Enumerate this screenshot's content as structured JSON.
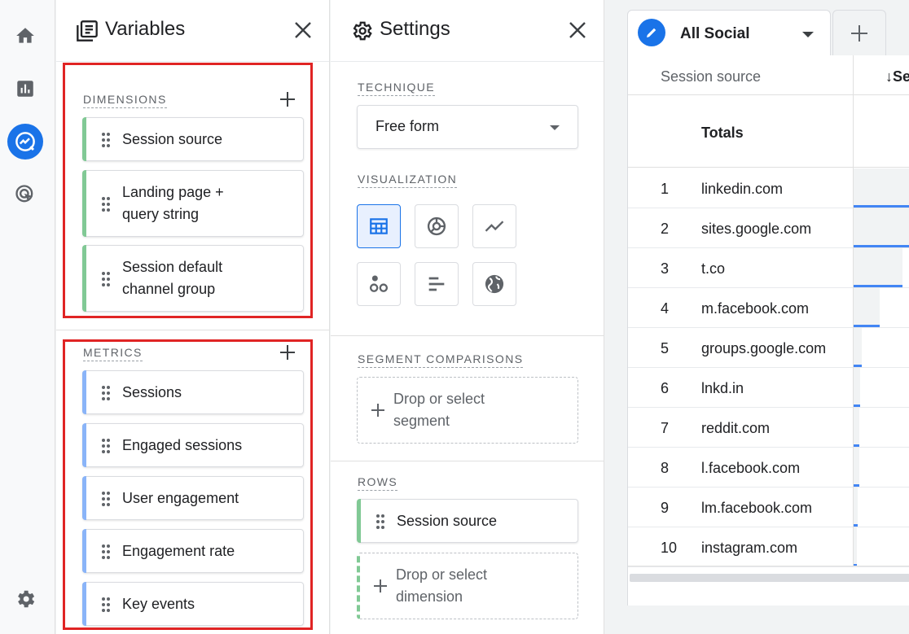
{
  "colors": {
    "accent": "#1a73e8",
    "dimension_bar": "#81c995",
    "metric_bar": "#8ab4f8",
    "highlight_box": "#e02424",
    "data_bar": "#4285f4"
  },
  "nav": {
    "items": [
      {
        "icon": "home-icon",
        "active": false
      },
      {
        "icon": "reports-icon",
        "active": false
      },
      {
        "icon": "explore-icon",
        "active": true
      },
      {
        "icon": "advertising-icon",
        "active": false
      }
    ],
    "settings_icon": "gear-icon"
  },
  "variables": {
    "title": "Variables",
    "dimensions_label": "DIMENSIONS",
    "dimensions": [
      {
        "line1": "Session source",
        "line2": ""
      },
      {
        "line1": "Landing page +",
        "line2": "query string"
      },
      {
        "line1": "Session default",
        "line2": "channel group"
      }
    ],
    "metrics_label": "METRICS",
    "metrics": [
      "Sessions",
      "Engaged sessions",
      "User engagement",
      "Engagement rate",
      "Key events"
    ]
  },
  "settings": {
    "title": "Settings",
    "technique_label": "TECHNIQUE",
    "technique_value": "Free form",
    "visualization_label": "VISUALIZATION",
    "visualizations": [
      {
        "icon": "table-icon",
        "selected": true
      },
      {
        "icon": "donut-chart-icon",
        "selected": false
      },
      {
        "icon": "line-chart-icon",
        "selected": false
      },
      {
        "icon": "scatter-plot-icon",
        "selected": false
      },
      {
        "icon": "bar-chart-icon",
        "selected": false
      },
      {
        "icon": "geo-map-icon",
        "selected": false
      }
    ],
    "segment_label": "SEGMENT COMPARISONS",
    "segment_drop": {
      "line1": "Drop or select",
      "line2": "segment"
    },
    "rows_label": "ROWS",
    "rows_item": "Session source",
    "rows_drop": {
      "line1": "Drop or select",
      "line2": "dimension"
    }
  },
  "tab": {
    "name": "All Social",
    "add_icon": "plus-icon"
  },
  "table": {
    "col1": "Session source",
    "col2": "↓Se",
    "totals_label": "Totals",
    "rows": [
      {
        "index": "1",
        "source": "linkedin.com",
        "share": 1.0
      },
      {
        "index": "2",
        "source": "sites.google.com",
        "share": 1.0
      },
      {
        "index": "3",
        "source": "t.co",
        "share": 0.85
      },
      {
        "index": "4",
        "source": "m.facebook.com",
        "share": 0.46
      },
      {
        "index": "5",
        "source": "groups.google.com",
        "share": 0.14
      },
      {
        "index": "6",
        "source": "lnkd.in",
        "share": 0.12
      },
      {
        "index": "7",
        "source": "reddit.com",
        "share": 0.1
      },
      {
        "index": "8",
        "source": "l.facebook.com",
        "share": 0.1
      },
      {
        "index": "9",
        "source": "lm.facebook.com",
        "share": 0.07
      },
      {
        "index": "10",
        "source": "instagram.com",
        "share": 0.05
      }
    ]
  }
}
